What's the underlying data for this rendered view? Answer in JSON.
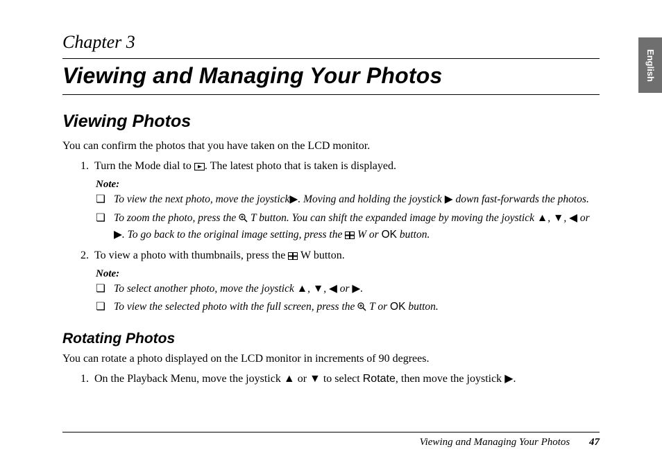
{
  "tab": "English",
  "chapter": "Chapter 3",
  "title": "Viewing and Managing Your Photos",
  "section1": {
    "heading": "Viewing Photos",
    "intro": "You can confirm the photos that you have taken on the LCD monitor.",
    "step1_a": "Turn the Mode dial to ",
    "step1_b": ". The latest photo that is taken is displayed.",
    "note_label": "Note:",
    "note1a_a": "To view the next photo, move the joystick",
    "note1a_b": ". Moving and holding the joystick ",
    "note1a_c": " down fast-forwards the photos.",
    "note1b_a": "To zoom the photo, press the ",
    "note1b_b": " T button. You can shift the expanded image by moving the joystick ",
    "note1b_c": ". To go back to the original image setting, press the ",
    "note1b_d": " W or ",
    "note1b_ok": "OK",
    "note1b_e": " button.",
    "dirs": ", ",
    "or": " or ",
    "step2_a": "To view a photo with thumbnails, press the ",
    "step2_b": " W button.",
    "note2a_a": "To select another photo, move the joystick ",
    "note2a_b": ".",
    "note2b_a": "To view the selected photo with the full screen, press the ",
    "note2b_b": " T or ",
    "note2b_ok": "OK",
    "note2b_c": " button."
  },
  "section2": {
    "heading": "Rotating Photos",
    "intro": "You can rotate a photo displayed on the LCD monitor in increments of 90 degrees.",
    "step1_a": "On the Playback Menu, move the joystick ",
    "step1_b": " or ",
    "step1_c": " to select ",
    "rotate": "Rotate",
    "step1_d": ", then move the joystick ",
    "step1_e": "."
  },
  "footer": {
    "title": "Viewing and Managing Your Photos",
    "page": "47"
  },
  "glyph": {
    "right": "▶",
    "left": "◀",
    "up": "▲",
    "down": "▼"
  }
}
